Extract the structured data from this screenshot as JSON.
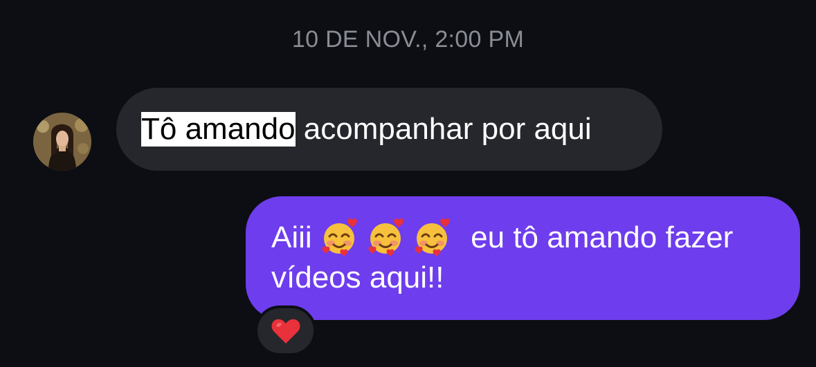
{
  "thread": {
    "timestamp": "10 DE NOV., 2:00 PM"
  },
  "incoming_message": {
    "sender_avatar": "profile-photo",
    "highlighted_text": "Tô amando",
    "rest_text": " acompanhar por aqui"
  },
  "outgoing_message": {
    "text_before_emojis": "Aiii",
    "emojis": [
      "smiling-face-with-hearts",
      "smiling-face-with-hearts",
      "smiling-face-with-hearts"
    ],
    "text_after_emojis": "eu tô amando fazer vídeos aqui!!"
  },
  "reaction": {
    "emoji": "red-heart"
  },
  "colors": {
    "background": "#0c0e13",
    "incoming_bubble": "#26272c",
    "outgoing_bubble": "#6e3ded",
    "timestamp_text": "#8a8d95",
    "heart": "#e8313a"
  }
}
